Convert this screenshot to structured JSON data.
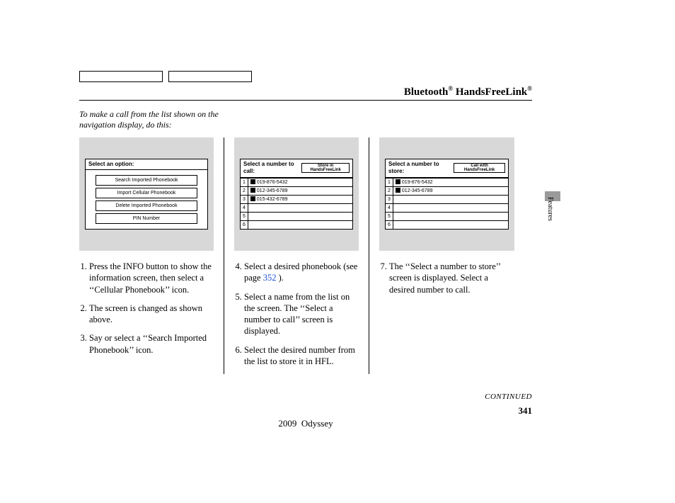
{
  "header": {
    "title_html": "Bluetooth® HandsFreeLink®"
  },
  "intro": "To make a call from the list shown on the navigation display, do this:",
  "col1": {
    "dialog_title": "Select an option:",
    "options": [
      "Search Imported Phonebook",
      "Import Cellular Phonebook",
      "Delete Imported Phonebook",
      "PIN Number"
    ],
    "steps": [
      "Press the INFO button to show the information screen, then select a ‘‘Cellular Phonebook’’ icon.",
      "The screen is changed as shown above.",
      "Say or select a ‘‘Search Imported Phonebook’’ icon."
    ]
  },
  "col2": {
    "dialog_title": "Select a number to call:",
    "badge": "Store in HandsFreeLink",
    "rows": [
      "019-876-5432",
      "012-345-6789",
      "015-432-6789",
      "",
      "",
      ""
    ],
    "step4_a": "Select a desired phonebook (see page ",
    "step4_link": "352",
    "step4_b": " ).",
    "step5": "Select a name from the list on the screen. The ‘‘Select a number to call’’ screen is displayed.",
    "step6": "Select the desired number from the list to store it in HFL."
  },
  "col3": {
    "dialog_title": "Select a number to store:",
    "badge": "Call with HandsFreeLink",
    "rows": [
      "019-876-5432",
      "012-345-6789",
      "",
      "",
      "",
      ""
    ],
    "step7": "The ‘‘Select a number to store’’ screen is displayed. Select a desired number to call."
  },
  "continued": "CONTINUED",
  "page_number": "341",
  "footer_model": "2009  Odyssey",
  "side_label": "Features"
}
